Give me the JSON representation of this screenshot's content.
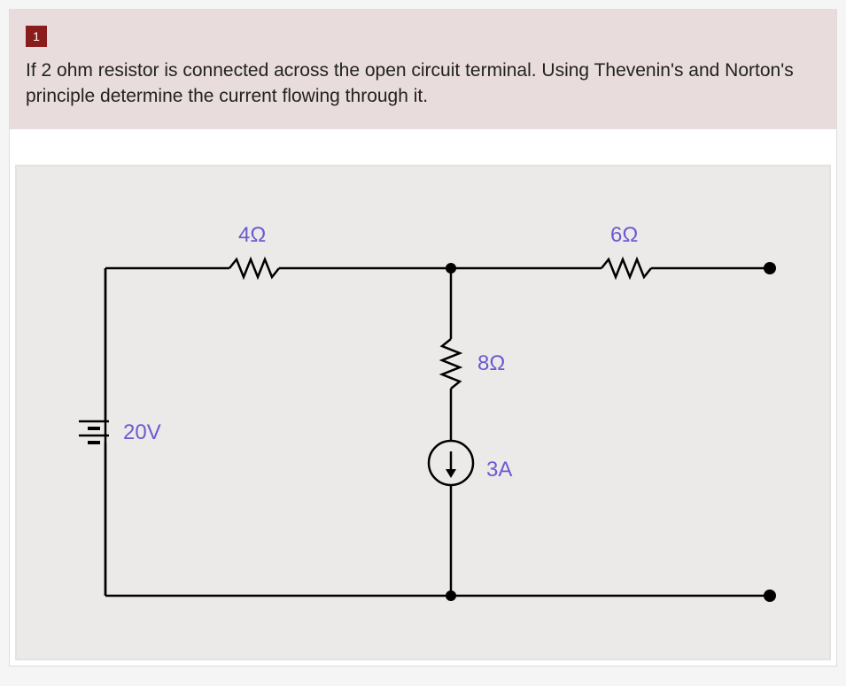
{
  "question": {
    "number": "1",
    "text": "If 2 ohm resistor is connected across the open circuit terminal. Using Thevenin's and Norton's principle determine the current flowing through it."
  },
  "circuit": {
    "voltage_source": "20V",
    "resistor_top_left": "4Ω",
    "resistor_top_right": "6Ω",
    "resistor_middle": "8Ω",
    "current_source": "3A"
  }
}
